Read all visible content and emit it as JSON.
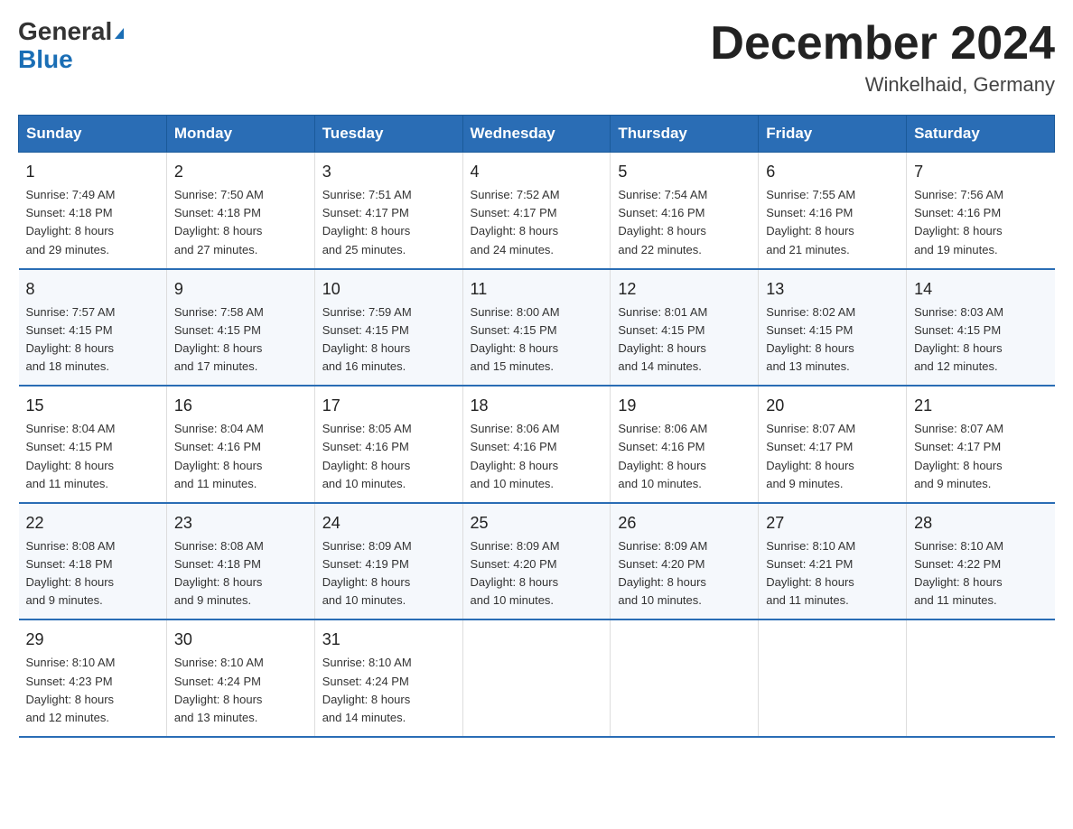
{
  "header": {
    "logo_general": "General",
    "logo_blue": "Blue",
    "title": "December 2024",
    "subtitle": "Winkelhaid, Germany"
  },
  "columns": [
    "Sunday",
    "Monday",
    "Tuesday",
    "Wednesday",
    "Thursday",
    "Friday",
    "Saturday"
  ],
  "weeks": [
    [
      {
        "day": "1",
        "sunrise": "7:49 AM",
        "sunset": "4:18 PM",
        "daylight": "8 hours and 29 minutes."
      },
      {
        "day": "2",
        "sunrise": "7:50 AM",
        "sunset": "4:18 PM",
        "daylight": "8 hours and 27 minutes."
      },
      {
        "day": "3",
        "sunrise": "7:51 AM",
        "sunset": "4:17 PM",
        "daylight": "8 hours and 25 minutes."
      },
      {
        "day": "4",
        "sunrise": "7:52 AM",
        "sunset": "4:17 PM",
        "daylight": "8 hours and 24 minutes."
      },
      {
        "day": "5",
        "sunrise": "7:54 AM",
        "sunset": "4:16 PM",
        "daylight": "8 hours and 22 minutes."
      },
      {
        "day": "6",
        "sunrise": "7:55 AM",
        "sunset": "4:16 PM",
        "daylight": "8 hours and 21 minutes."
      },
      {
        "day": "7",
        "sunrise": "7:56 AM",
        "sunset": "4:16 PM",
        "daylight": "8 hours and 19 minutes."
      }
    ],
    [
      {
        "day": "8",
        "sunrise": "7:57 AM",
        "sunset": "4:15 PM",
        "daylight": "8 hours and 18 minutes."
      },
      {
        "day": "9",
        "sunrise": "7:58 AM",
        "sunset": "4:15 PM",
        "daylight": "8 hours and 17 minutes."
      },
      {
        "day": "10",
        "sunrise": "7:59 AM",
        "sunset": "4:15 PM",
        "daylight": "8 hours and 16 minutes."
      },
      {
        "day": "11",
        "sunrise": "8:00 AM",
        "sunset": "4:15 PM",
        "daylight": "8 hours and 15 minutes."
      },
      {
        "day": "12",
        "sunrise": "8:01 AM",
        "sunset": "4:15 PM",
        "daylight": "8 hours and 14 minutes."
      },
      {
        "day": "13",
        "sunrise": "8:02 AM",
        "sunset": "4:15 PM",
        "daylight": "8 hours and 13 minutes."
      },
      {
        "day": "14",
        "sunrise": "8:03 AM",
        "sunset": "4:15 PM",
        "daylight": "8 hours and 12 minutes."
      }
    ],
    [
      {
        "day": "15",
        "sunrise": "8:04 AM",
        "sunset": "4:15 PM",
        "daylight": "8 hours and 11 minutes."
      },
      {
        "day": "16",
        "sunrise": "8:04 AM",
        "sunset": "4:16 PM",
        "daylight": "8 hours and 11 minutes."
      },
      {
        "day": "17",
        "sunrise": "8:05 AM",
        "sunset": "4:16 PM",
        "daylight": "8 hours and 10 minutes."
      },
      {
        "day": "18",
        "sunrise": "8:06 AM",
        "sunset": "4:16 PM",
        "daylight": "8 hours and 10 minutes."
      },
      {
        "day": "19",
        "sunrise": "8:06 AM",
        "sunset": "4:16 PM",
        "daylight": "8 hours and 10 minutes."
      },
      {
        "day": "20",
        "sunrise": "8:07 AM",
        "sunset": "4:17 PM",
        "daylight": "8 hours and 9 minutes."
      },
      {
        "day": "21",
        "sunrise": "8:07 AM",
        "sunset": "4:17 PM",
        "daylight": "8 hours and 9 minutes."
      }
    ],
    [
      {
        "day": "22",
        "sunrise": "8:08 AM",
        "sunset": "4:18 PM",
        "daylight": "8 hours and 9 minutes."
      },
      {
        "day": "23",
        "sunrise": "8:08 AM",
        "sunset": "4:18 PM",
        "daylight": "8 hours and 9 minutes."
      },
      {
        "day": "24",
        "sunrise": "8:09 AM",
        "sunset": "4:19 PM",
        "daylight": "8 hours and 10 minutes."
      },
      {
        "day": "25",
        "sunrise": "8:09 AM",
        "sunset": "4:20 PM",
        "daylight": "8 hours and 10 minutes."
      },
      {
        "day": "26",
        "sunrise": "8:09 AM",
        "sunset": "4:20 PM",
        "daylight": "8 hours and 10 minutes."
      },
      {
        "day": "27",
        "sunrise": "8:10 AM",
        "sunset": "4:21 PM",
        "daylight": "8 hours and 11 minutes."
      },
      {
        "day": "28",
        "sunrise": "8:10 AM",
        "sunset": "4:22 PM",
        "daylight": "8 hours and 11 minutes."
      }
    ],
    [
      {
        "day": "29",
        "sunrise": "8:10 AM",
        "sunset": "4:23 PM",
        "daylight": "8 hours and 12 minutes."
      },
      {
        "day": "30",
        "sunrise": "8:10 AM",
        "sunset": "4:24 PM",
        "daylight": "8 hours and 13 minutes."
      },
      {
        "day": "31",
        "sunrise": "8:10 AM",
        "sunset": "4:24 PM",
        "daylight": "8 hours and 14 minutes."
      },
      null,
      null,
      null,
      null
    ]
  ],
  "labels": {
    "sunrise_prefix": "Sunrise: ",
    "sunset_prefix": "Sunset: ",
    "daylight_prefix": "Daylight: "
  }
}
